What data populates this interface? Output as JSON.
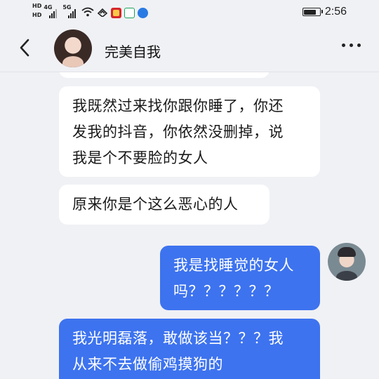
{
  "status_bar": {
    "hd_badges": [
      "HD",
      "HD"
    ],
    "network_types": [
      "4G",
      "5G"
    ],
    "signal_levels": [
      0.75,
      1.0
    ],
    "wifi_icon": "wifi-icon",
    "battery_level": 0.85,
    "time": "2:56"
  },
  "header": {
    "back_icon": "chevron-left-icon",
    "contact_name": "完美自我",
    "more_icon": "more-horizontal-icon"
  },
  "messages": [
    {
      "direction": "received",
      "text": ""
    },
    {
      "direction": "received",
      "lines": [
        "我既然过来找你跟你睡了，你还",
        "发我的抖音，你依然没删掉，说",
        "我是个不要脸的女人"
      ]
    },
    {
      "direction": "received",
      "lines": [
        "原来你是个这么恶心的人"
      ]
    },
    {
      "direction": "sent",
      "lines": [
        "我是找睡觉的女人",
        "吗？？？？？？"
      ]
    },
    {
      "direction": "sent",
      "lines": [
        "我光明磊落，敢做该当？？？我",
        "从来不去做偷鸡摸狗的"
      ]
    }
  ],
  "colors": {
    "background": "#f0f1f5",
    "received_bubble": "#ffffff",
    "sent_bubble": "#3d73ef",
    "sent_text": "#ffffff"
  }
}
